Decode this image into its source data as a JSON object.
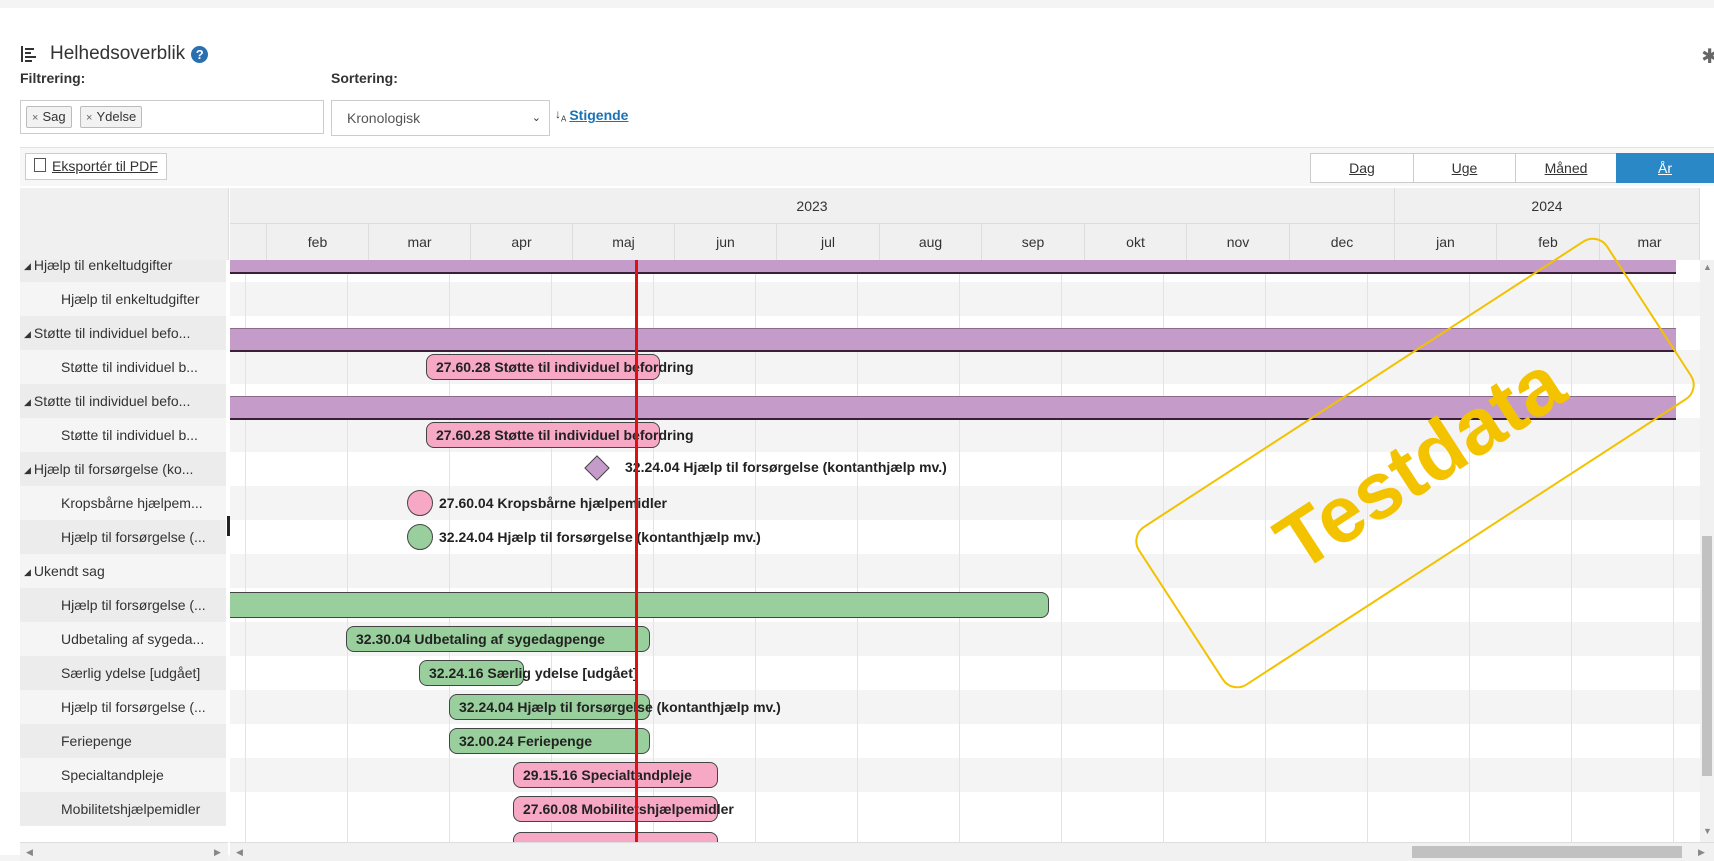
{
  "header": {
    "title": "Helhedsoverblik",
    "help_icon": "?"
  },
  "filter": {
    "label": "Filtrering:",
    "chips": [
      "Sag",
      "Ydelse"
    ]
  },
  "sort": {
    "label": "Sortering:",
    "selected": "Kronologisk",
    "direction": "Stigende"
  },
  "toolbar": {
    "export_label": "Eksportér til PDF",
    "views": [
      {
        "label": "Dag"
      },
      {
        "label": "Uge"
      },
      {
        "label": "Måned"
      },
      {
        "label": "År",
        "active": true
      }
    ]
  },
  "timeline": {
    "years": [
      "2023",
      "2024"
    ],
    "months": [
      "",
      "feb",
      "mar",
      "apr",
      "maj",
      "jun",
      "jul",
      "aug",
      "sep",
      "okt",
      "nov",
      "dec",
      "jan",
      "feb",
      "mar"
    ]
  },
  "rows": [
    {
      "label": "Hjælp til enkeltudgifter",
      "group": true
    },
    {
      "label": "Hjælp til enkeltudgifter",
      "group": false
    },
    {
      "label": "Støtte til individuel befo...",
      "group": true
    },
    {
      "label": "Støtte til individuel b...",
      "group": false
    },
    {
      "label": "Støtte til individuel befo...",
      "group": true
    },
    {
      "label": "Støtte til individuel b...",
      "group": false
    },
    {
      "label": "Hjælp til forsørgelse (ko...",
      "group": true
    },
    {
      "label": "Kropsbårne hjælpem...",
      "group": false
    },
    {
      "label": "Hjælp til forsørgelse (...",
      "group": false
    },
    {
      "label": "Ukendt sag",
      "group": true
    },
    {
      "label": "Hjælp til forsørgelse (...",
      "group": false
    },
    {
      "label": "Udbetaling af sygeda...",
      "group": false
    },
    {
      "label": "Særlig ydelse [udgået]",
      "group": false
    },
    {
      "label": "Hjælp til forsørgelse (...",
      "group": false
    },
    {
      "label": "Feriepenge",
      "group": false
    },
    {
      "label": "Specialtandpleje",
      "group": false
    },
    {
      "label": "Mobilitetshjælpemidler",
      "group": false
    }
  ],
  "bars": {
    "b1": "27.60.28 Støtte til individuel befordring",
    "b2": "27.60.28 Støtte til individuel befordring",
    "diamond": "32.24.04 Hjælp til forsørgelse (kontanthjælp mv.)",
    "dot1": "27.60.04 Kropsbårne hjælpemidler",
    "dot2": "32.24.04 Hjælp til forsørgelse (kontanthjælp mv.)",
    "b3": "32.30.04 Udbetaling af sygedagpenge",
    "b4": "32.24.16 Særlig ydelse [udgået]",
    "b5": "32.24.04 Hjælp til forsørgelse (kontanthjælp mv.)",
    "b6": "32.00.24 Feriepenge",
    "b7": "29.15.16 Specialtandpleje",
    "b8": "27.60.08 Mobilitetshjælpemidler"
  },
  "watermark": "Testdata",
  "colors": {
    "purple": "#c59cc9",
    "pink": "#f7a8c4",
    "green": "#98cf9c",
    "today_line": "#e01010",
    "active_view": "#2a88c6",
    "watermark": "#f4c300"
  }
}
